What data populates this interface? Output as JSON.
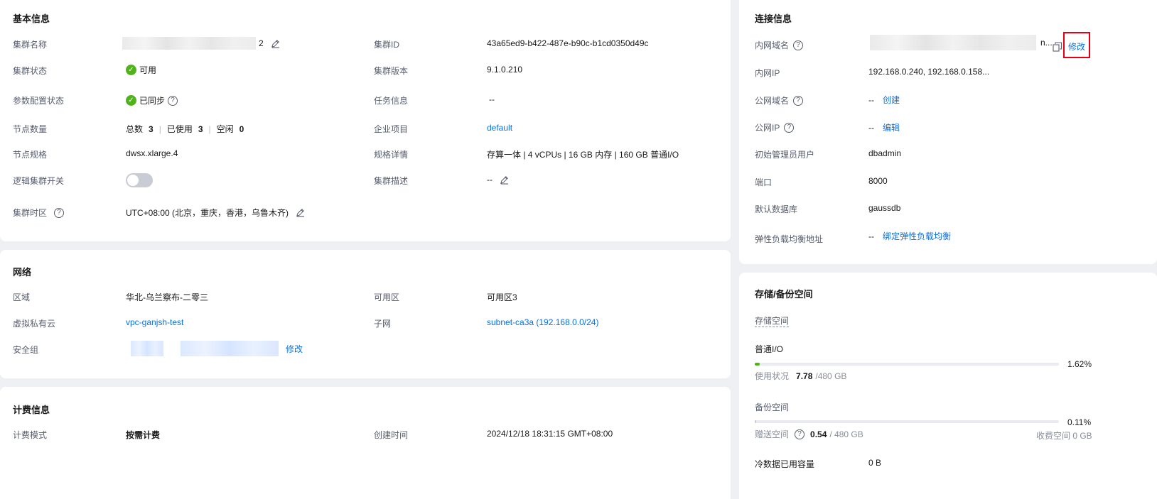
{
  "basic": {
    "title": "基本信息",
    "cluster_name_label": "集群名称",
    "cluster_name_suffix": "2",
    "cluster_status_label": "集群状态",
    "cluster_status_value": "可用",
    "param_status_label": "参数配置状态",
    "param_status_value": "已同步",
    "node_count_label": "节点数量",
    "node_total_label": "总数",
    "node_total": "3",
    "node_used_label": "已使用",
    "node_used": "3",
    "node_idle_label": "空闲",
    "node_idle": "0",
    "node_spec_label": "节点规格",
    "node_spec_value": "dwsx.xlarge.4",
    "logical_label": "逻辑集群开关",
    "timezone_label": "集群时区",
    "timezone_value": "UTC+08:00 (北京，重庆，香港，乌鲁木齐)",
    "cluster_id_label": "集群ID",
    "cluster_id_value": "43a65ed9-b422-487e-b90c-b1cd0350d49c",
    "cluster_version_label": "集群版本",
    "cluster_version_value": "9.1.0.210",
    "task_label": "任务信息",
    "task_value": "--",
    "enterprise_label": "企业项目",
    "enterprise_value": "default",
    "spec_detail_label": "规格详情",
    "spec_detail_value": "存算一体 | 4 vCPUs | 16 GB 内存 | 160 GB 普通I/O",
    "desc_label": "集群描述",
    "desc_value": "--"
  },
  "network": {
    "title": "网络",
    "region_label": "区域",
    "region_value": "华北-乌兰察布-二零三",
    "vpc_label": "虚拟私有云",
    "vpc_value": "vpc-ganjsh-test",
    "sg_label": "安全组",
    "sg_modify": "修改",
    "az_label": "可用区",
    "az_value": "可用区3",
    "subnet_label": "子网",
    "subnet_value": "subnet-ca3a (192.168.0.0/24)"
  },
  "billing": {
    "title": "计费信息",
    "mode_label": "计费模式",
    "mode_value": "按需计费",
    "created_label": "创建时间",
    "created_value": "2024/12/18 18:31:15 GMT+08:00"
  },
  "connection": {
    "title": "连接信息",
    "private_domain_label": "内网域名",
    "private_domain_tail": "n...",
    "private_domain_modify": "修改",
    "private_ip_label": "内网IP",
    "private_ip_value": "192.168.0.240, 192.168.0.158...",
    "public_domain_label": "公网域名",
    "public_domain_value": "--",
    "public_domain_action": "创建",
    "public_ip_label": "公网IP",
    "public_ip_value": "--",
    "public_ip_action": "编辑",
    "admin_label": "初始管理员用户",
    "admin_value": "dbadmin",
    "port_label": "端口",
    "port_value": "8000",
    "db_label": "默认数据库",
    "db_value": "gaussdb",
    "elb_label": "弹性负载均衡地址",
    "elb_value": "--",
    "elb_action": "绑定弹性负载均衡"
  },
  "storage": {
    "title": "存储/备份空间",
    "storage_space_label": "存储空间",
    "normal_io_label": "普通I/O",
    "normal_io_percent": "1.62%",
    "normal_io_fraction": 0.0162,
    "usage_label": "使用状况",
    "usage_used": "7.78",
    "usage_total": "/480 GB",
    "backup_label": "备份空间",
    "backup_percent": "0.11%",
    "backup_fraction": 0.0011,
    "gift_label": "赠送空间",
    "gift_used": "0.54",
    "gift_total": "/ 480 GB",
    "charged_label": "收费空间 0 GB",
    "cold_label": "冷数据已用容量",
    "cold_value": "0 B"
  },
  "colors": {
    "link": "#0a70e0",
    "success": "#50b319",
    "highlight": "#e60012"
  }
}
